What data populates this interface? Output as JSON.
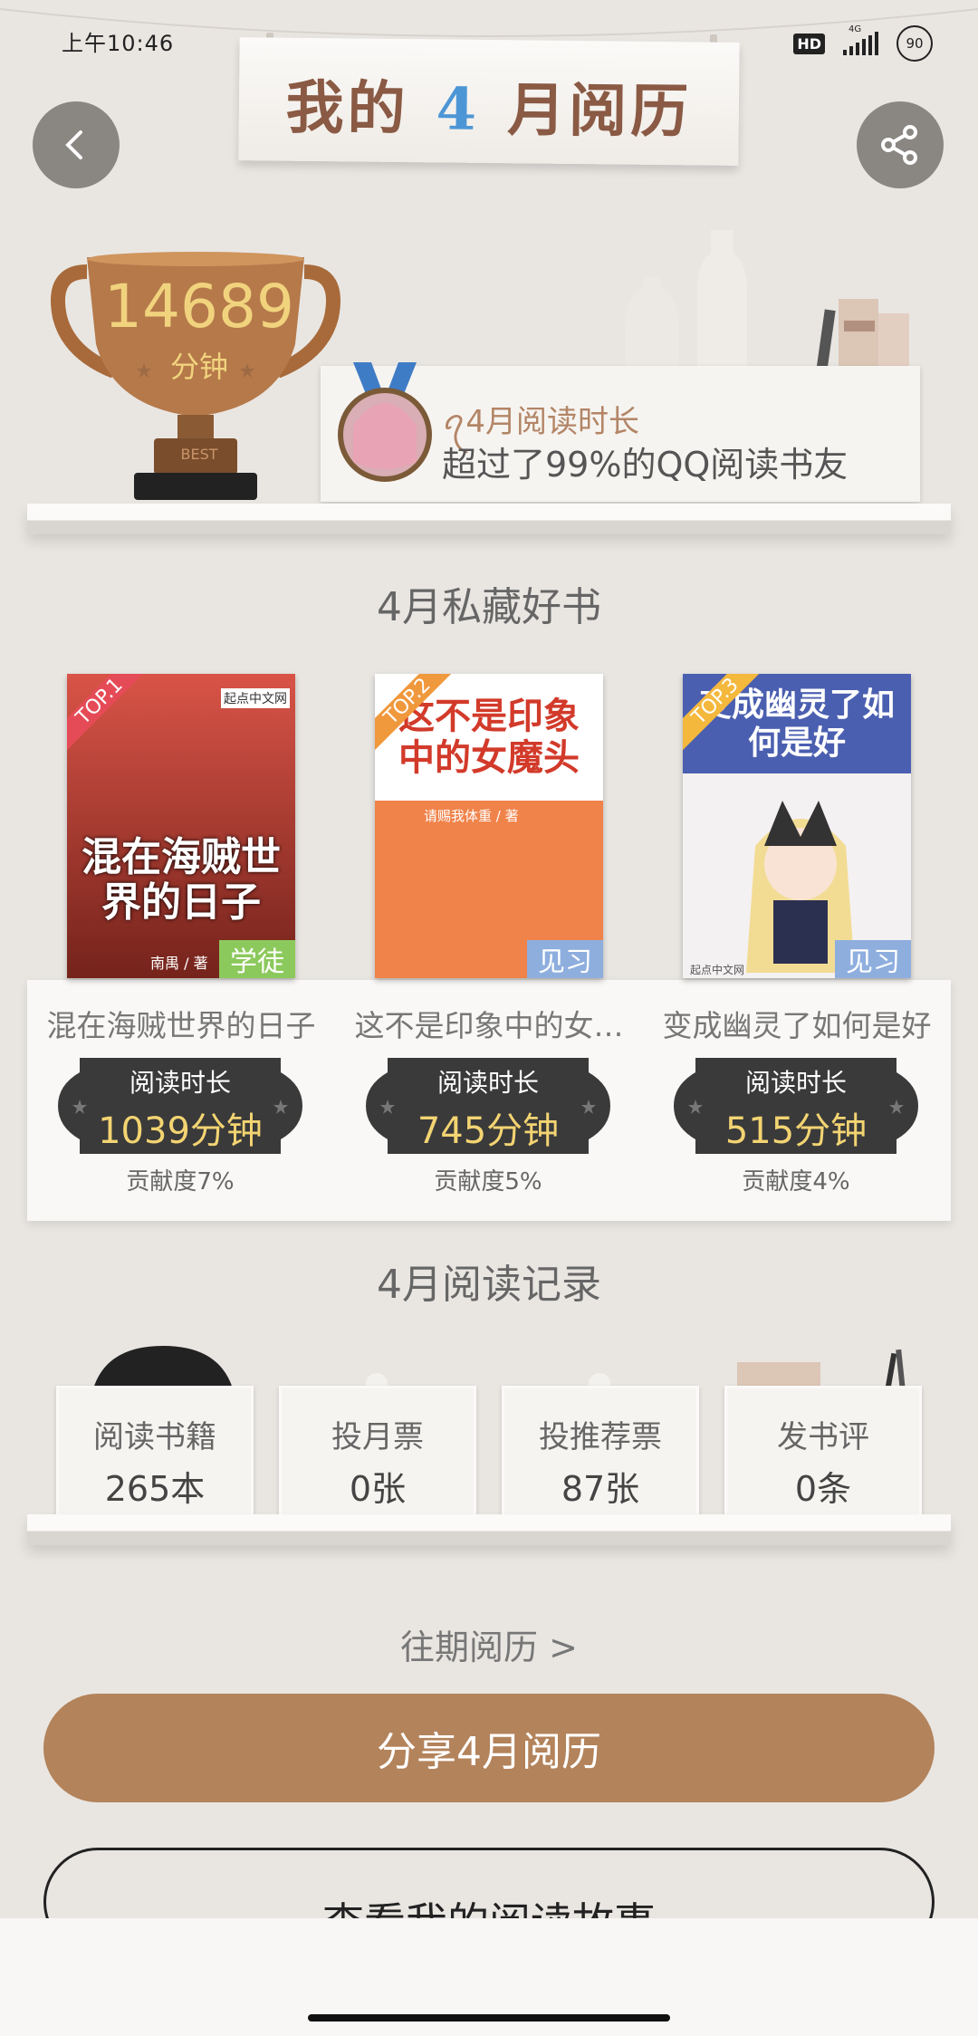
{
  "status_bar": {
    "time": "上午10:46",
    "hd": "HD",
    "network": "4G",
    "battery": "90"
  },
  "header": {
    "title_prefix": "我的",
    "title_month": "4",
    "title_suffix": "月阅历"
  },
  "summary": {
    "minutes": "14689",
    "minutes_unit": "分钟",
    "trophy_tag": "BEST",
    "rank_label": "ꪖ4月阅读时长",
    "rank_desc": "超过了99%的QQ阅读书友"
  },
  "favorites": {
    "title": "4月私藏好书",
    "books": [
      {
        "rank": "TOP.1",
        "title": "混在海贼世界的日子",
        "level": "学徒",
        "level_color": "#8cc95c",
        "cover_color": "#d44032",
        "cover_text": "混在海贼世界的日子",
        "publisher": "起点中文网",
        "author_line": "南禺 / 著",
        "badge_label": "阅读时长",
        "badge_value": "1039分钟",
        "contribution": "贡献度7%"
      },
      {
        "rank": "TOP.2",
        "title": "这不是印象中的女…",
        "level": "见习",
        "level_color": "#8eaede",
        "cover_color": "#f0834a",
        "cover_text": "这不是印象中的女魔头",
        "author_line": "请赐我体重 / 著",
        "badge_label": "阅读时长",
        "badge_value": "745分钟",
        "contribution": "贡献度5%"
      },
      {
        "rank": "TOP.3",
        "title": "变成幽灵了如何是好",
        "level": "见习",
        "level_color": "#8eaede",
        "cover_color": "#4b5fb0",
        "cover_text": "变成幽灵了如何是好",
        "publisher": "起点中文网",
        "badge_label": "阅读时长",
        "badge_value": "515分钟",
        "contribution": "贡献度4%"
      }
    ]
  },
  "records": {
    "title": "4月阅读记录",
    "items": [
      {
        "label": "阅读书籍",
        "value": "265本"
      },
      {
        "label": "投月票",
        "value": "0张"
      },
      {
        "label": "投推荐票",
        "value": "87张"
      },
      {
        "label": "发书评",
        "value": "0条"
      }
    ]
  },
  "actions": {
    "history": "往期阅历 >",
    "share": "分享4月阅历",
    "story": "查看我的阅读故事"
  },
  "colors": {
    "accent_brown": "#b3835b",
    "gold": "#f3d472",
    "banner_text": "#8a5a44",
    "month_blue": "#4d96d6"
  }
}
